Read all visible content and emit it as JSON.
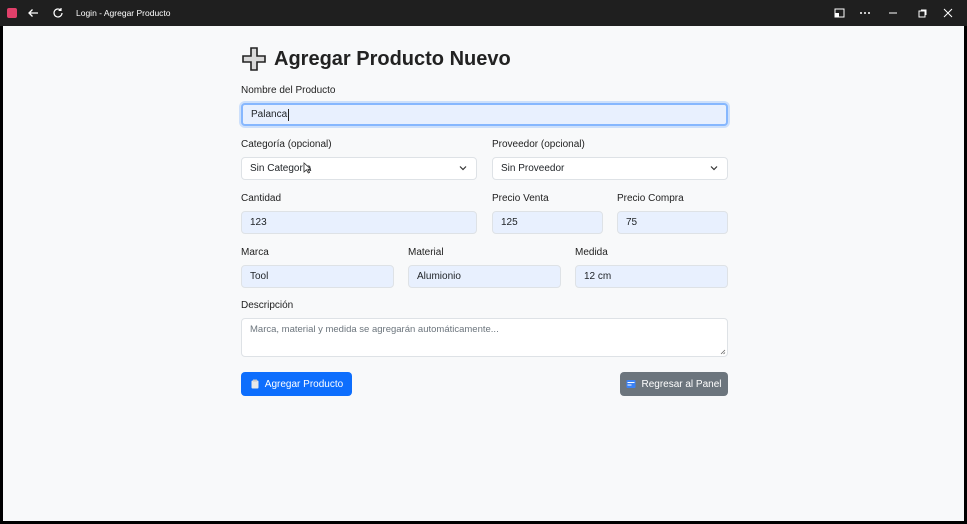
{
  "window": {
    "title": "Login - Agregar Producto",
    "icons": {
      "app": "app-logo-icon",
      "back": "arrow-left-icon",
      "reload": "refresh-icon",
      "cast": "cast-icon",
      "more": "more-icon",
      "minimize": "minimize-icon",
      "maximize": "maximize-icon",
      "close": "close-icon"
    }
  },
  "page": {
    "title": "Agregar Producto Nuevo",
    "title_icon": "plus-icon"
  },
  "form": {
    "nombre": {
      "label": "Nombre del Producto",
      "value": "Palanca"
    },
    "categoria": {
      "label": "Categoría (opcional)",
      "value": "Sin Categoría"
    },
    "proveedor": {
      "label": "Proveedor (opcional)",
      "value": "Sin Proveedor"
    },
    "cantidad": {
      "label": "Cantidad",
      "value": "123"
    },
    "precio_venta": {
      "label": "Precio Venta",
      "value": "125"
    },
    "precio_compra": {
      "label": "Precio Compra",
      "value": "75"
    },
    "marca": {
      "label": "Marca",
      "value": "Tool"
    },
    "material": {
      "label": "Material",
      "value": "Alumionio"
    },
    "medida": {
      "label": "Medida",
      "value": "12 cm"
    },
    "descripcion": {
      "label": "Descripción",
      "placeholder": "Marca, material y medida se agregarán automáticamente..."
    }
  },
  "buttons": {
    "agregar": {
      "label": "Agregar Producto",
      "icon": "clipboard-icon"
    },
    "regresar": {
      "label": "Regresar al Panel",
      "icon": "panel-icon"
    }
  },
  "colors": {
    "primary": "#0d6efd",
    "secondary": "#6c757d",
    "filled_field": "#e8f0fe",
    "titlebar": "#1f1f1f"
  }
}
